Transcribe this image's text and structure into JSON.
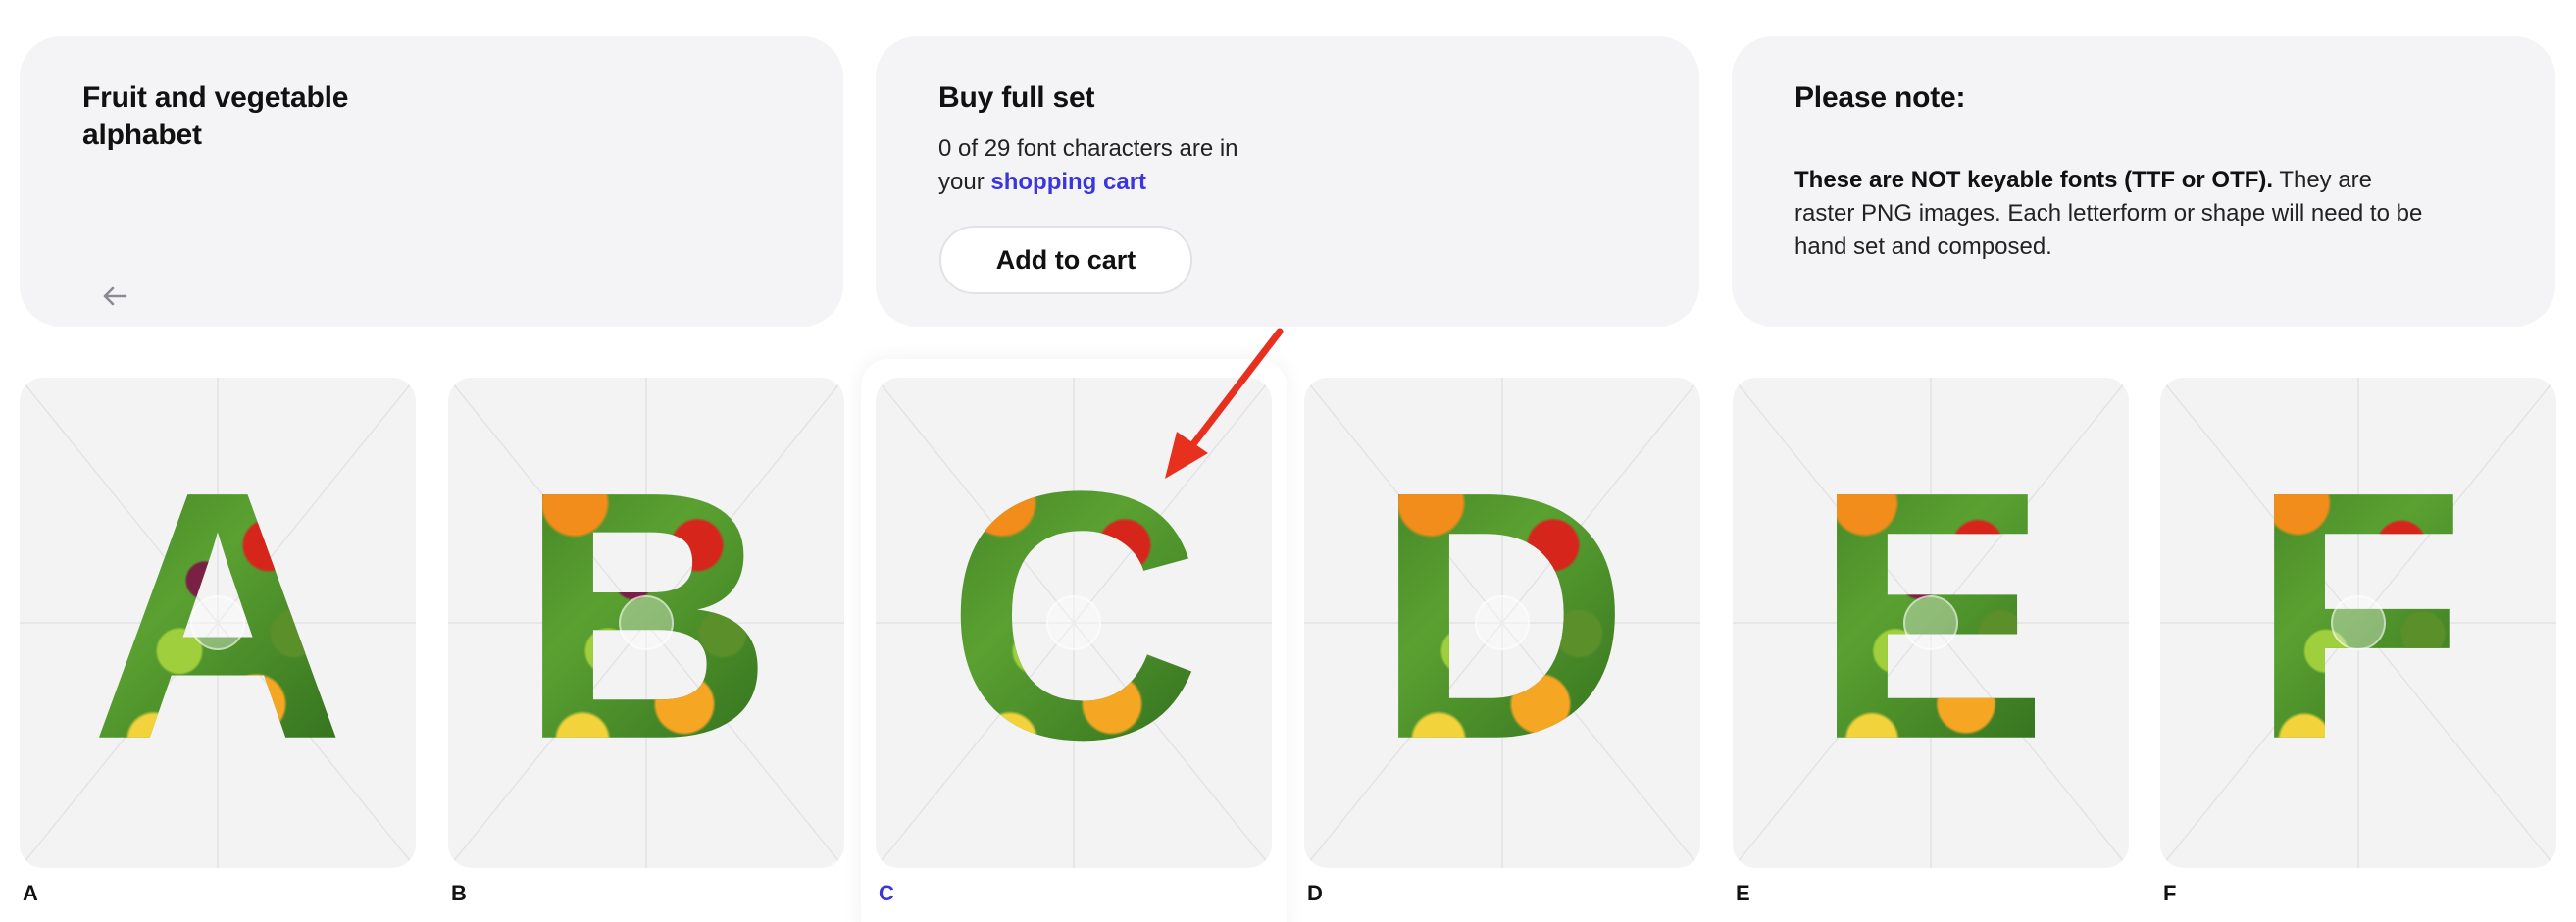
{
  "intro": {
    "title": "Fruit and vegetable alphabet",
    "back_icon": "arrow-left-icon"
  },
  "buy": {
    "title": "Buy full set",
    "cart_text": "0 of 29 font characters are in your",
    "cart_link": "shopping cart",
    "add_button": "Add to cart"
  },
  "note": {
    "title": "Please note:",
    "bold": "These are NOT keyable fonts (TTF or OTF).",
    "body": "They are raster PNG images. Each letterform or shape will need to be hand set and composed."
  },
  "letters": [
    {
      "char": "A",
      "label": "A",
      "active": false
    },
    {
      "char": "B",
      "label": "B",
      "active": false
    },
    {
      "char": "C",
      "label": "C",
      "active": true
    },
    {
      "char": "D",
      "label": "D",
      "active": false
    },
    {
      "char": "E",
      "label": "E",
      "active": false
    },
    {
      "char": "F",
      "label": "F",
      "active": false
    }
  ],
  "colors": {
    "accent": "#3b35e0",
    "card_bg": "#f4f4f6",
    "annotation_arrow": "#e8301f"
  }
}
